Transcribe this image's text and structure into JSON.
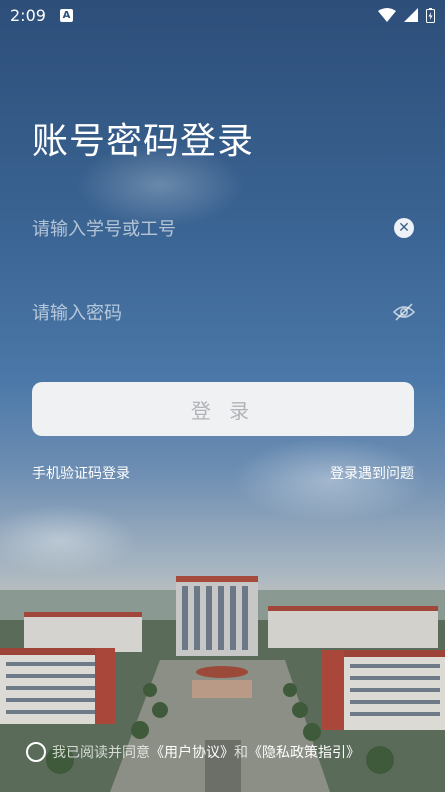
{
  "status_bar": {
    "time": "2:09",
    "notification": "A"
  },
  "title": "账号密码登录",
  "username": {
    "placeholder": "请输入学号或工号"
  },
  "password": {
    "placeholder": "请输入密码"
  },
  "login_button": "登 录",
  "links": {
    "sms_login": "手机验证码登录",
    "help": "登录遇到问题"
  },
  "agreement": {
    "prefix": "我已阅读并同意",
    "user_agreement": "《用户协议》",
    "and": "和",
    "privacy": "《隐私政策指引》"
  }
}
